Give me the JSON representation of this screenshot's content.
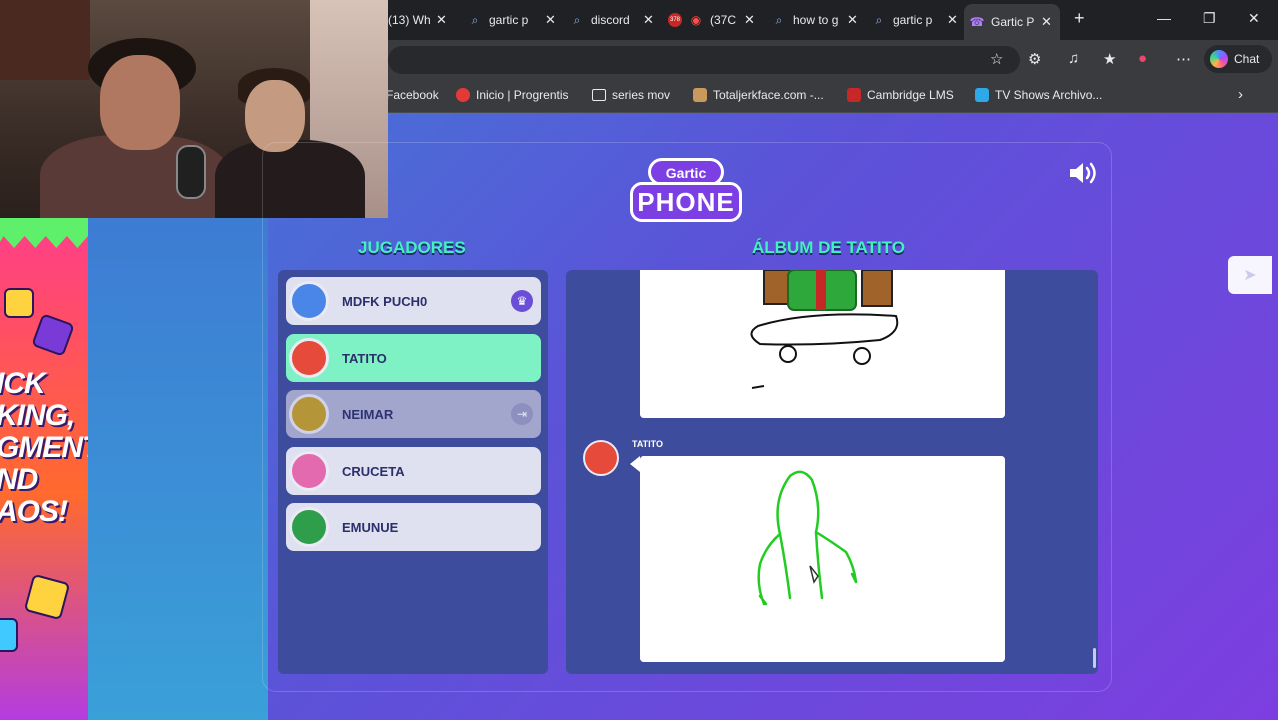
{
  "browser": {
    "tabs": [
      {
        "title": "(13) Wh",
        "icon": "whatsapp-icon"
      },
      {
        "title": "gartic p",
        "icon": "search-icon"
      },
      {
        "title": "discord",
        "icon": "search-icon"
      },
      {
        "title": "(37C",
        "icon": "youtube-icon",
        "badge": "378"
      },
      {
        "title": "how to g",
        "icon": "search-icon"
      },
      {
        "title": "gartic p",
        "icon": "search-icon"
      },
      {
        "title": "Gartic P",
        "icon": "gartic-icon",
        "active": true
      }
    ],
    "new_tab": "+",
    "chat_label": "Chat",
    "bookmarks": [
      {
        "label": "Facebook",
        "color": "#1877f2"
      },
      {
        "label": "Inicio | Progrentis",
        "color": "#e53935"
      },
      {
        "label": "series mov",
        "color": "folder"
      },
      {
        "label": "Totaljerkface.com -...",
        "color": "#c99a5b"
      },
      {
        "label": "Cambridge LMS",
        "color": "#c62828"
      },
      {
        "label": "TV Shows Archivo...",
        "color": "#2ea8e6"
      }
    ]
  },
  "ad": {
    "text_lines": [
      "ICK",
      "KING,",
      "GMENT",
      "ND",
      "AOS!"
    ]
  },
  "game": {
    "logo_top": "Gartic",
    "logo_bottom": "PHONE",
    "players_title": "JUGADORES",
    "album_title": "ÁLBUM DE TATITO",
    "players": [
      {
        "name": "MDFK PUCH0",
        "state": "host",
        "avatar_color": "#4a86e8"
      },
      {
        "name": "TATITO",
        "state": "highlight",
        "avatar_color": "#e64a3a"
      },
      {
        "name": "NEIMAR",
        "state": "disconnected",
        "avatar_color": "#c9a227"
      },
      {
        "name": "CRUCETA",
        "state": "normal",
        "avatar_color": "#e46ab0"
      },
      {
        "name": "EMUNUE",
        "state": "normal",
        "avatar_color": "#2e9e4a"
      }
    ],
    "message_author": "TATITO",
    "colors": {
      "accent": "#44f0c2",
      "panel": "#3d4c9c",
      "highlight": "#7ef2c4",
      "drawing_green": "#22cc22"
    }
  }
}
